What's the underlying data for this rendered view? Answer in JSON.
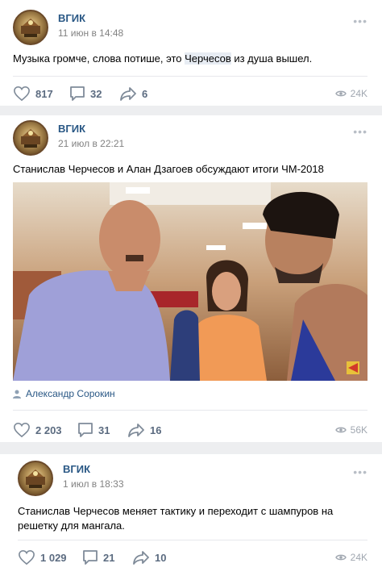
{
  "posts": [
    {
      "author": "ВГИК",
      "date": "11 июн в 14:48",
      "text_before": "Музыка громче, слова потише, это ",
      "text_highlight": "Черчесов",
      "text_after": " из душа вышел.",
      "likes": "817",
      "comments": "32",
      "shares": "6",
      "views": "24K"
    },
    {
      "author": "ВГИК",
      "date": "21 июл в 22:21",
      "text": "Станислав Черчесов и Алан Дзагоев обсуждают итоги ЧМ-2018",
      "signer": "Александр Сорокин",
      "likes": "2 203",
      "comments": "31",
      "shares": "16",
      "views": "56K"
    },
    {
      "author": "ВГИК",
      "date": "1 июл в 18:33",
      "text": "Станислав Черчесов меняет тактику и переходит с шампуров на решетку для мангала.",
      "likes": "1 029",
      "comments": "21",
      "shares": "10",
      "views": "24K"
    }
  ],
  "icons": {
    "like": "heart-icon",
    "comment": "comment-icon",
    "share": "share-icon",
    "views": "eye-icon",
    "more": "more-icon",
    "signer": "user-icon"
  },
  "colors": {
    "link": "#2a5885",
    "muted": "#828282",
    "action": "#5b6b80",
    "background": "#edeef0"
  }
}
